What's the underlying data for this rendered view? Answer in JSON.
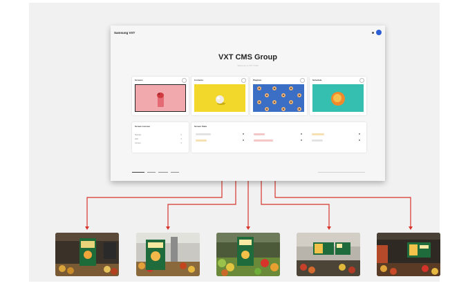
{
  "app": {
    "logo": "Samsung VXT",
    "title": "VXT CMS Group",
    "subtitle": "Welcome to VXT CMS"
  },
  "cards": [
    {
      "title": "Screens",
      "color": "#f1a8ab",
      "icon_name": "screen-preview"
    },
    {
      "title": "Contents",
      "color": "#f2da2a",
      "icon_name": "content-preview"
    },
    {
      "title": "Playlists",
      "color": "#3b6fc5",
      "icon_name": "playlist-preview"
    },
    {
      "title": "Schedule",
      "color": "#34bfb0",
      "icon_name": "schedule-preview"
    }
  ],
  "licenses": {
    "title": "Screen License",
    "rows": [
      {
        "label": "Signage",
        "value": "0"
      },
      {
        "label": "LED",
        "value": "0"
      },
      {
        "label": "Content",
        "value": "0"
      }
    ]
  },
  "status": {
    "title": "Screen Stats"
  },
  "colors": {
    "accent": "#d6332a",
    "status_gray": "#e3e3e3",
    "status_red": "#f5c8c8",
    "status_yellow": "#f7e1b2"
  }
}
